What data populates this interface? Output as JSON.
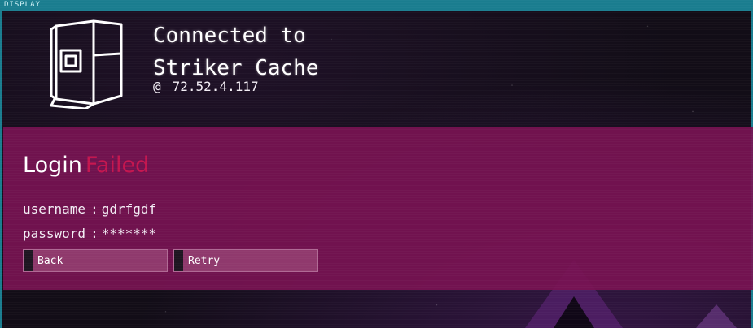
{
  "window": {
    "title": "DISPLAY"
  },
  "connection": {
    "title_line1": "Connected to",
    "title_line2": "Striker Cache",
    "at_symbol": "@",
    "ip": "72.52.4.117",
    "icon": "computer-tower-icon"
  },
  "login": {
    "heading": "Login",
    "status": "Failed",
    "username_label": "username",
    "username_value": "gdrfgdf",
    "password_label": "password",
    "password_value": "*******",
    "separator": ":"
  },
  "buttons": {
    "back_label": "Back",
    "retry_label": "Retry"
  },
  "colors": {
    "titlebar": "#1a7d8f",
    "panel": "#78125a",
    "failed": "#c4154e",
    "button": "#aa5a87"
  }
}
